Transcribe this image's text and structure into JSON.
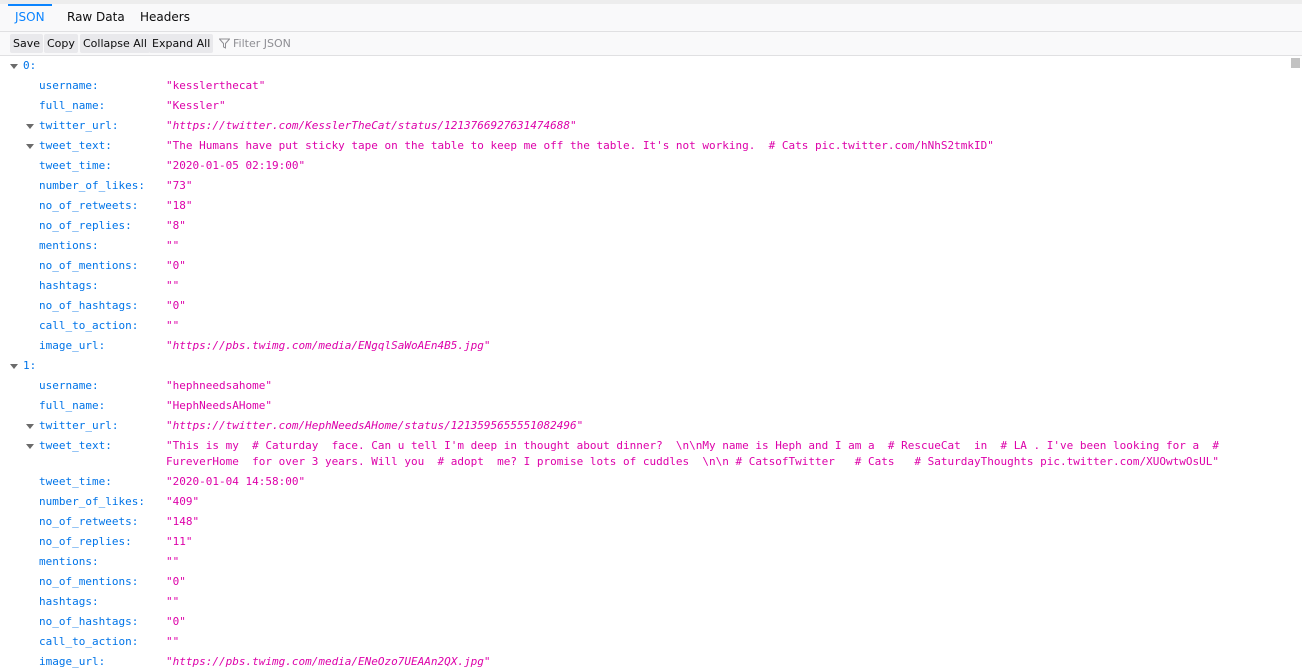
{
  "tabs": [
    {
      "label": "JSON",
      "active": true
    },
    {
      "label": "Raw Data",
      "active": false
    },
    {
      "label": "Headers",
      "active": false
    }
  ],
  "toolbar": {
    "save_label": "Save",
    "copy_label": "Copy",
    "collapse_label": "Collapse All",
    "expand_label": "Expand All",
    "filter_placeholder": "Filter JSON",
    "filter_icon": "funnel-icon"
  },
  "colors": {
    "accent": "#0a84ff",
    "key": "#0074e8",
    "string": "#dd00a9"
  },
  "records": [
    {
      "index_label": "0:",
      "fields": [
        {
          "key": "username:",
          "value": "\"kesslerthecat\""
        },
        {
          "key": "full_name:",
          "value": "\"Kessler\""
        },
        {
          "key": "twitter_url:",
          "value": "\"https://twitter.com/KesslerTheCat/status/1213766927631474688\""
        },
        {
          "key": "tweet_text:",
          "value": "\"The Humans have put sticky tape on the table to keep me off the table. It's not working.  # Cats pic.twitter.com/hNhS2tmkID\""
        },
        {
          "key": "tweet_time:",
          "value": "\"2020-01-05 02:19:00\""
        },
        {
          "key": "number_of_likes:",
          "value": "\"73\""
        },
        {
          "key": "no_of_retweets:",
          "value": "\"18\""
        },
        {
          "key": "no_of_replies:",
          "value": "\"8\""
        },
        {
          "key": "mentions:",
          "value": "\"\""
        },
        {
          "key": "no_of_mentions:",
          "value": "\"0\""
        },
        {
          "key": "hashtags:",
          "value": "\"\""
        },
        {
          "key": "no_of_hashtags:",
          "value": "\"0\""
        },
        {
          "key": "call_to_action:",
          "value": "\"\""
        },
        {
          "key": "image_url:",
          "value": "\"https://pbs.twimg.com/media/ENgqlSaWoAEn4B5.jpg\""
        }
      ]
    },
    {
      "index_label": "1:",
      "fields": [
        {
          "key": "username:",
          "value": "\"hephneedsahome\""
        },
        {
          "key": "full_name:",
          "value": "\"HephNeedsAHome\""
        },
        {
          "key": "twitter_url:",
          "value": "\"https://twitter.com/HephNeedsAHome/status/1213595655551082496\""
        },
        {
          "key": "tweet_text:",
          "value": "\"This is my  # Caturday  face. Can u tell I'm deep in thought about dinner?  \\n\\nMy name is Heph and I am a  # RescueCat  in  # LA . I've been looking for a  #\nFureverHome  for over 3 years. Will you  # adopt  me? I promise lots of cuddles  \\n\\n # CatsofTwitter   # Cats   # SaturdayThoughts pic.twitter.com/XUOwtwOsUL\""
        },
        {
          "key": "tweet_time:",
          "value": "\"2020-01-04 14:58:00\""
        },
        {
          "key": "number_of_likes:",
          "value": "\"409\""
        },
        {
          "key": "no_of_retweets:",
          "value": "\"148\""
        },
        {
          "key": "no_of_replies:",
          "value": "\"11\""
        },
        {
          "key": "mentions:",
          "value": "\"\""
        },
        {
          "key": "no_of_mentions:",
          "value": "\"0\""
        },
        {
          "key": "hashtags:",
          "value": "\"\""
        },
        {
          "key": "no_of_hashtags:",
          "value": "\"0\""
        },
        {
          "key": "call_to_action:",
          "value": "\"\""
        },
        {
          "key": "image_url:",
          "value": "\"https://pbs.twimg.com/media/ENeOzo7UEAAn2QX.jpg\""
        }
      ]
    }
  ]
}
